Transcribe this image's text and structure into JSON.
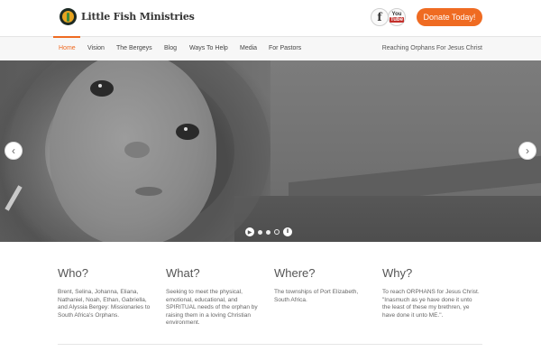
{
  "site": {
    "name": "Little Fish Ministries",
    "donate_label": "Donate Today!",
    "social": {
      "facebook": "f",
      "youtube_top": "You",
      "youtube_bottom": "Tube"
    },
    "accent_color": "#ef6b22"
  },
  "nav": {
    "items": [
      {
        "label": "Home",
        "active": true
      },
      {
        "label": "Vision"
      },
      {
        "label": "The Bergeys"
      },
      {
        "label": "Blog"
      },
      {
        "label": "Ways To Help"
      },
      {
        "label": "Media"
      },
      {
        "label": "For Pastors"
      }
    ],
    "tagline": "Reaching Orphans For Jesus Christ"
  },
  "slider": {
    "prev_icon": "‹",
    "next_icon": "›",
    "play_icon": "▶",
    "pause_icon": "ǁ",
    "slide_count": 3,
    "active_slide": 3
  },
  "columns": [
    {
      "title": "Who?",
      "text": "Brent, Selina, Johanna, Eliana, Nathaniel, Noah, Ethan, Gabriella, and Alyssia Bergey: Missionaries to South Africa's Orphans."
    },
    {
      "title": "What?",
      "text": "Seeking to meet the physical, emotional, educational, and SPIRITUAL needs of the orphan by raising them in a loving Christian environment."
    },
    {
      "title": "Where?",
      "text": "The townships of Port Elizabeth, South Africa."
    },
    {
      "title": "Why?",
      "text": "To reach ORPHANS for Jesus Christ. \"Inasmuch as ye have done it unto the least of these my brethren, ye have done it unto ME.\"."
    }
  ]
}
